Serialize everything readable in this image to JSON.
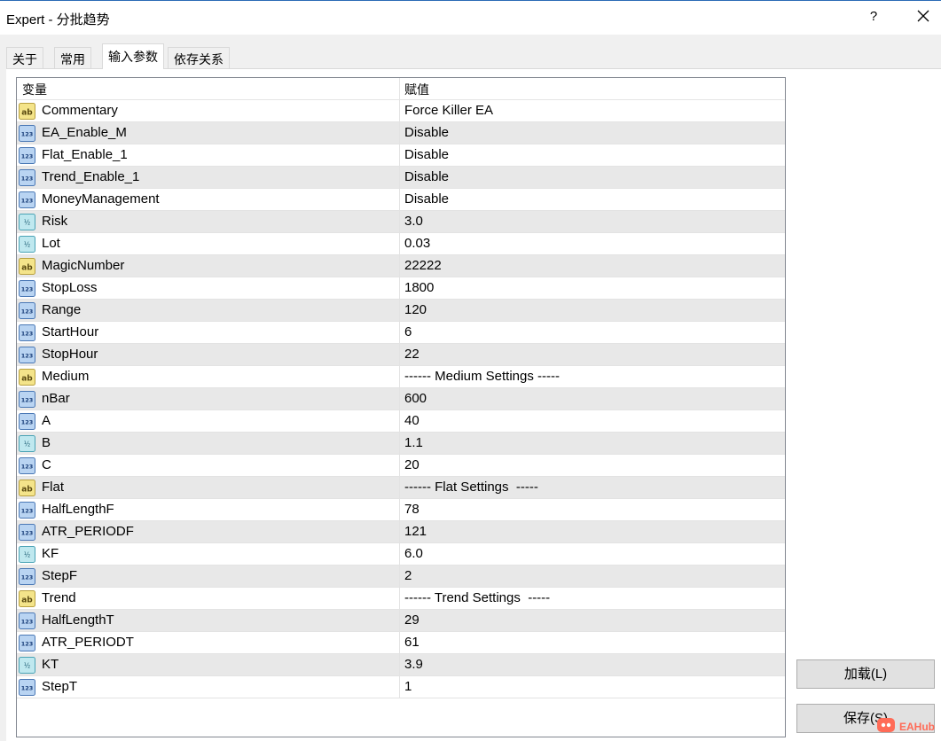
{
  "window": {
    "title": "Expert - 分批趋势",
    "help_label": "?"
  },
  "tabs": [
    {
      "label": "关于"
    },
    {
      "label": "常用"
    },
    {
      "label": "输入参数"
    },
    {
      "label": "依存关系"
    }
  ],
  "table": {
    "headers": {
      "variable": "变量",
      "value": "赋值"
    },
    "rows": [
      {
        "type": "ab-icon",
        "name": "Commentary",
        "value": "Force Killer EA"
      },
      {
        "type": "int-icon",
        "name": "EA_Enable_M",
        "value": "Disable"
      },
      {
        "type": "int-icon",
        "name": "Flat_Enable_1",
        "value": "Disable"
      },
      {
        "type": "int-icon",
        "name": "Trend_Enable_1",
        "value": "Disable"
      },
      {
        "type": "int-icon",
        "name": "MoneyManagement",
        "value": "Disable"
      },
      {
        "type": "double-icon",
        "name": "Risk",
        "value": "3.0"
      },
      {
        "type": "double-icon",
        "name": "Lot",
        "value": "0.03"
      },
      {
        "type": "ab-icon",
        "name": "MagicNumber",
        "value": "22222"
      },
      {
        "type": "int-icon",
        "name": "StopLoss",
        "value": "1800"
      },
      {
        "type": "int-icon",
        "name": "Range",
        "value": "120"
      },
      {
        "type": "int-icon",
        "name": "StartHour",
        "value": "6"
      },
      {
        "type": "int-icon",
        "name": "StopHour",
        "value": "22"
      },
      {
        "type": "ab-icon",
        "name": "Medium",
        "value": "------ Medium Settings -----"
      },
      {
        "type": "int-icon",
        "name": "nBar",
        "value": "600"
      },
      {
        "type": "int-icon",
        "name": "A",
        "value": "40"
      },
      {
        "type": "double-icon",
        "name": "B",
        "value": "1.1"
      },
      {
        "type": "int-icon",
        "name": "C",
        "value": "20"
      },
      {
        "type": "ab-icon",
        "name": "Flat",
        "value": "------ Flat Settings  -----"
      },
      {
        "type": "int-icon",
        "name": "HalfLengthF",
        "value": "78"
      },
      {
        "type": "int-icon",
        "name": "ATR_PERIODF",
        "value": "121"
      },
      {
        "type": "double-icon",
        "name": "KF",
        "value": "6.0"
      },
      {
        "type": "int-icon",
        "name": "StepF",
        "value": "2"
      },
      {
        "type": "ab-icon",
        "name": "Trend",
        "value": "------ Trend Settings  -----"
      },
      {
        "type": "int-icon",
        "name": "HalfLengthT",
        "value": "29"
      },
      {
        "type": "int-icon",
        "name": "ATR_PERIODT",
        "value": "61"
      },
      {
        "type": "double-icon",
        "name": "KT",
        "value": "3.9"
      },
      {
        "type": "int-icon",
        "name": "StepT",
        "value": "1"
      }
    ]
  },
  "buttons": {
    "load": "加载(L)",
    "save": "保存(S)"
  },
  "watermark": {
    "text": "EAHub",
    "icon": "eahub-logo-icon"
  },
  "colors": {
    "accent": "#2a6bb5",
    "alt_row": "#e8e8e8",
    "watermark": "#ff6b57"
  }
}
